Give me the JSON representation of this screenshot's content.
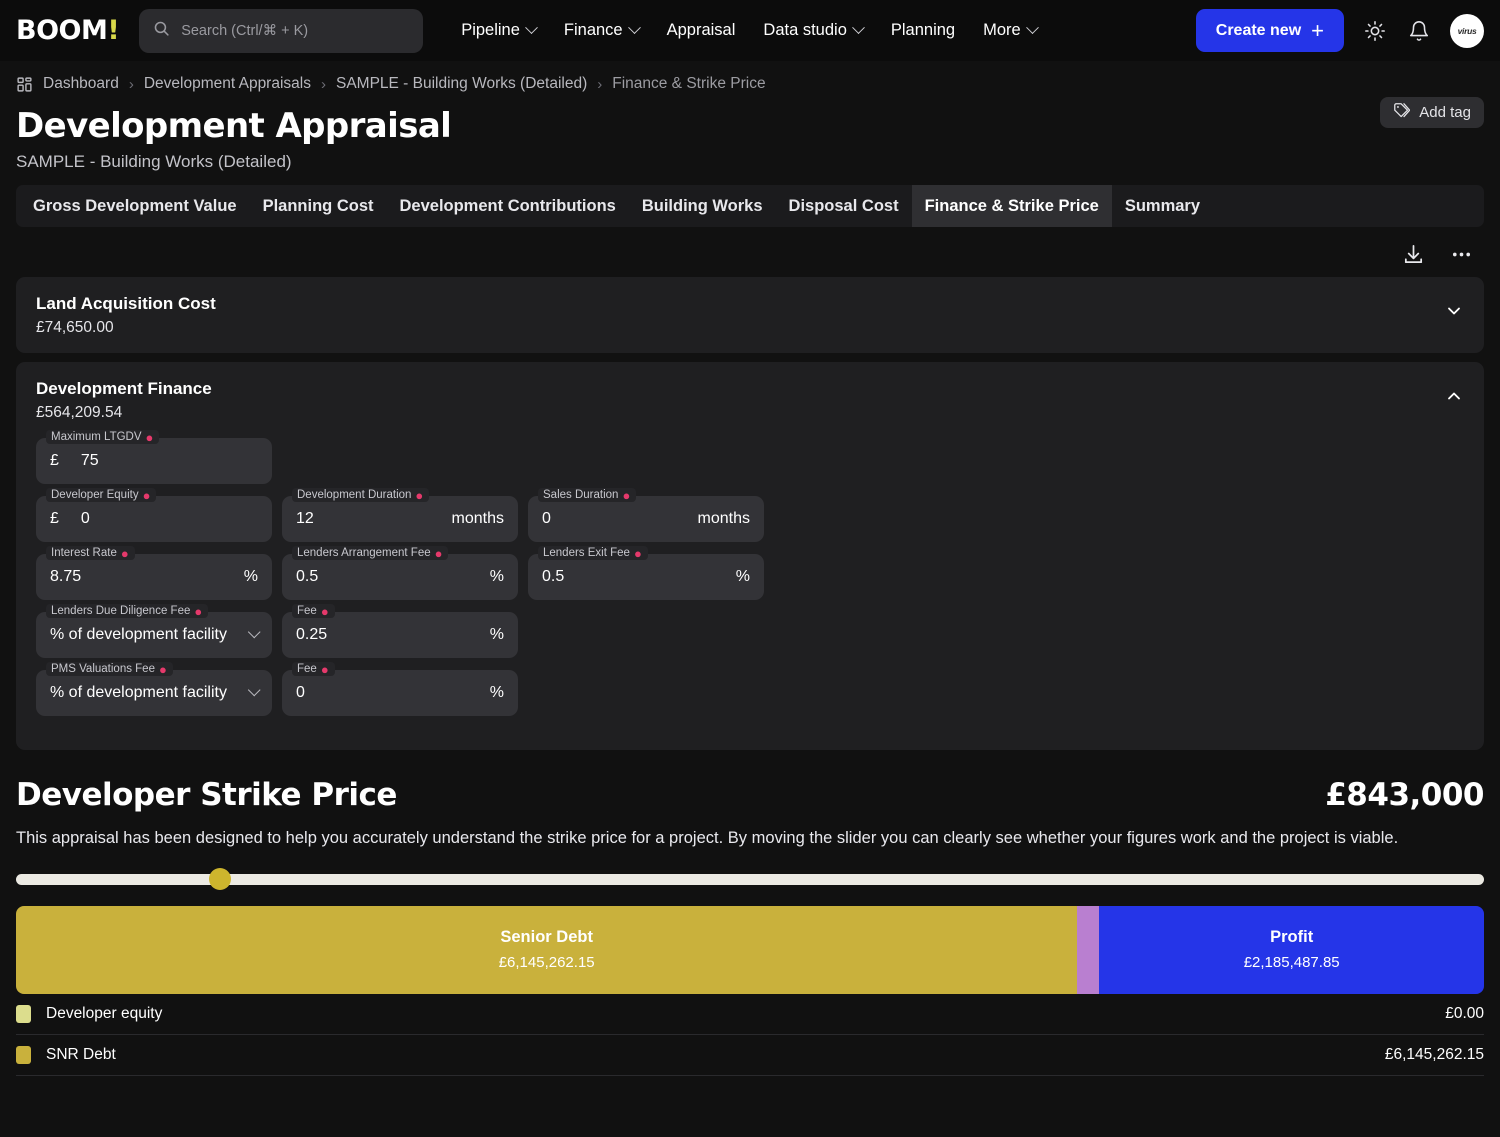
{
  "header": {
    "logo": "BOOM",
    "logo_bang": "!",
    "search_placeholder": "Search (Ctrl/⌘ + K)",
    "search_icon": "search-icon",
    "nav": [
      {
        "label": "Pipeline",
        "has_chevron": true
      },
      {
        "label": "Finance",
        "has_chevron": true
      },
      {
        "label": "Appraisal",
        "has_chevron": false
      },
      {
        "label": "Data studio",
        "has_chevron": true
      },
      {
        "label": "Planning",
        "has_chevron": false
      },
      {
        "label": "More",
        "has_chevron": true
      }
    ],
    "create_button": "Create new",
    "create_plus": "+",
    "theme_icon": "sun-icon",
    "bell_icon": "bell-icon",
    "avatar_text": "virus",
    "accent_blue": "#2535e8"
  },
  "breadcrumb": {
    "home_icon": "dashboard-grid-icon",
    "separator": "›",
    "items": [
      "Dashboard",
      "Development Appraisals",
      "SAMPLE - Building Works (Detailed)",
      "Finance & Strike Price"
    ]
  },
  "page": {
    "title": "Development Appraisal",
    "subtitle": "SAMPLE - Building Works (Detailed)",
    "add_tag_label": "Add tag",
    "add_tag_icon": "tag-icon"
  },
  "tabs": {
    "items": [
      {
        "label": "Gross Development Value",
        "active": false
      },
      {
        "label": "Planning Cost",
        "active": false
      },
      {
        "label": "Development Contributions",
        "active": false
      },
      {
        "label": "Building Works",
        "active": false
      },
      {
        "label": "Disposal Cost",
        "active": false
      },
      {
        "label": "Finance & Strike Price",
        "active": true
      },
      {
        "label": "Summary",
        "active": false
      }
    ]
  },
  "toolbar": {
    "download_icon": "download-icon",
    "more_icon": "ellipsis-icon"
  },
  "cards": {
    "land": {
      "title": "Land Acquisition Cost",
      "value": "£74,650.00",
      "chevron": "chevron-down-icon",
      "expanded": false
    },
    "finance": {
      "title": "Development Finance",
      "value": "£564,209.54",
      "chevron": "chevron-up-icon",
      "expanded": true,
      "fields": {
        "max_ltgdv": {
          "label": "Maximum LTGDV",
          "required": true,
          "prefix": "£",
          "value": "75"
        },
        "developer_equity": {
          "label": "Developer Equity",
          "required": true,
          "prefix": "£",
          "value": "0"
        },
        "development_duration": {
          "label": "Development Duration",
          "required": true,
          "value": "12",
          "suffix": "months"
        },
        "sales_duration": {
          "label": "Sales Duration",
          "required": true,
          "value": "0",
          "suffix": "months"
        },
        "interest_rate": {
          "label": "Interest Rate",
          "required": true,
          "value": "8.75",
          "suffix": "%"
        },
        "lenders_arrangement_fee": {
          "label": "Lenders Arrangement Fee",
          "required": true,
          "value": "0.5",
          "suffix": "%"
        },
        "lenders_exit_fee": {
          "label": "Lenders Exit Fee",
          "required": true,
          "value": "0.5",
          "suffix": "%"
        },
        "lenders_dd_fee": {
          "label": "Lenders Due Diligence Fee",
          "required": true,
          "value": "% of development facility",
          "is_select": true
        },
        "lenders_dd_fee_amount": {
          "label": "Fee",
          "required": true,
          "value": "0.25",
          "suffix": "%"
        },
        "pms_valuations_fee": {
          "label": "PMS Valuations Fee",
          "required": true,
          "value": "% of development facility",
          "is_select": true
        },
        "pms_valuations_fee_amount": {
          "label": "Fee",
          "required": true,
          "value": "0",
          "suffix": "%"
        }
      }
    }
  },
  "strike": {
    "title": "Developer Strike Price",
    "amount": "£843,000",
    "description": "This appraisal has been designed to help you accurately understand the strike price for a project. By moving the slider you can clearly see whether your figures work and the project is viable.",
    "slider": {
      "position_percent": 13.9,
      "thumb_color": "#cdb52d",
      "track_color": "#eceae3"
    }
  },
  "chart_data": {
    "type": "bar",
    "title": "Developer Strike Price capital stack",
    "orientation": "horizontal-stacked",
    "segments": [
      {
        "name": "Senior Debt",
        "value": 6145262.15,
        "value_label": "£6,145,262.15",
        "color": "#c9b13c",
        "width_percent": 72.3
      },
      {
        "name": "",
        "value": 0,
        "value_label": "",
        "color": "#b97fd0",
        "width_percent": 1.5
      },
      {
        "name": "Profit",
        "value": 2185487.85,
        "value_label": "£2,185,487.85",
        "color": "#2535e8",
        "width_percent": 26.2
      }
    ],
    "legend": [
      {
        "label": "Developer equity",
        "value": "£0.00",
        "color": "#dcdd8d"
      },
      {
        "label": "SNR Debt",
        "value": "£6,145,262.15",
        "color": "#c9b13c"
      }
    ]
  }
}
